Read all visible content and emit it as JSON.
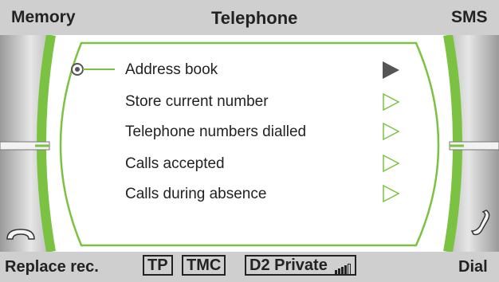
{
  "header": {
    "left_label": "Memory",
    "title": "Telephone",
    "right_label": "SMS"
  },
  "menu": {
    "items": [
      {
        "label": "Address book",
        "selected": true
      },
      {
        "label": "Store current number",
        "selected": false
      },
      {
        "label": "Telephone numbers dialled",
        "selected": false
      },
      {
        "label": "Calls accepted",
        "selected": false
      },
      {
        "label": "Calls during absence",
        "selected": false
      }
    ]
  },
  "footer": {
    "replace_label": "Replace rec.",
    "tp_label": "TP",
    "tmc_label": "TMC",
    "network_label": "D2 Private",
    "signal_bars_filled": 4,
    "signal_bars_total": 5,
    "dial_label": "Dial"
  },
  "colors": {
    "accent_green": "#7cc242",
    "bar_gray": "#cfcfcf",
    "text_dark": "#222222"
  },
  "icons": {
    "hang_up": "hang-up-phone-icon",
    "pick_up": "pick-up-phone-icon"
  }
}
